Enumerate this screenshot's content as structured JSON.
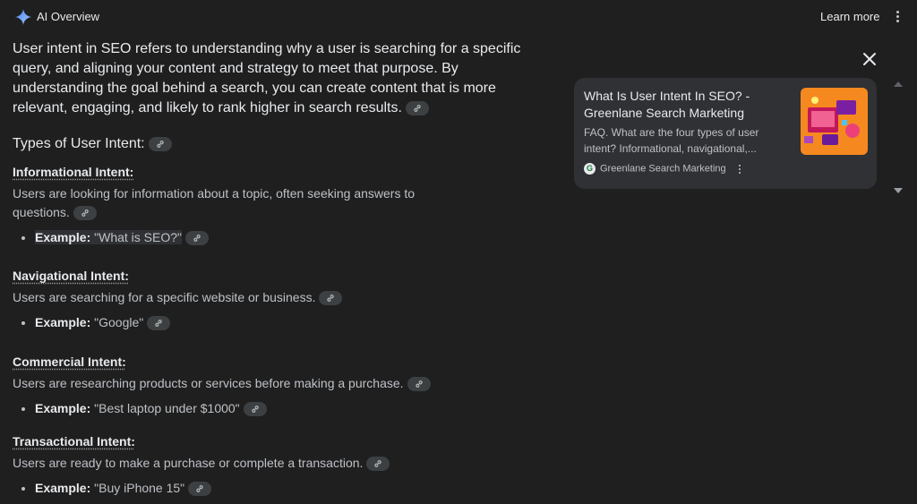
{
  "header": {
    "title": "AI Overview",
    "learn_more": "Learn more"
  },
  "intro": {
    "text": "User intent in SEO refers to understanding why a user is searching for a specific query, and aligning your content and strategy to meet that purpose. By understanding the goal behind a search, you can create content that is more relevant, engaging, and likely to rank higher in search results."
  },
  "types_heading": "Types of User Intent:",
  "sections": [
    {
      "heading": "Informational Intent:",
      "description": "Users are looking for information about a topic, often seeking answers to questions.",
      "example_label": "Example:",
      "example_value": " \"What is SEO?\""
    },
    {
      "heading": "Navigational Intent:",
      "description": "Users are searching for a specific website or business.",
      "example_label": "Example:",
      "example_value": " \"Google\""
    },
    {
      "heading": "Commercial Intent:",
      "description": "Users are researching products or services before making a purchase.",
      "example_label": "Example:",
      "example_value": " \"Best laptop under $1000\""
    },
    {
      "heading": "Transactional Intent:",
      "description": "Users are ready to make a purchase or complete a transaction.",
      "example_label": "Example:",
      "example_value": " \"Buy iPhone 15\""
    }
  ],
  "source_card": {
    "title": "What Is User Intent In SEO? - Greenlane Search Marketing",
    "description": "FAQ. What are the four types of user intent? Informational, navigational,...",
    "source_name": "Greenlane Search Marketing",
    "favicon_letter": "G"
  },
  "icons": {
    "header": "gemini-sparkle-icon",
    "link": "link-icon",
    "close": "close-icon",
    "menu": "more-vert-icon"
  },
  "colors": {
    "background": "#1f1f1f",
    "card": "#303134",
    "thumbnail": "#f5891f"
  }
}
